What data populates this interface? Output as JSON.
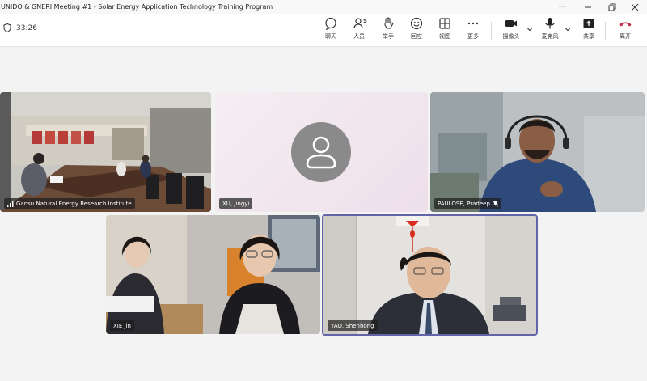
{
  "window": {
    "title": "UNIDO & GNERI Meeting #1 - Solar Energy Application Technology Training Program"
  },
  "toolbar": {
    "timer": "33:26",
    "chat_label": "聊天",
    "people_label": "人员",
    "people_count": "5",
    "raise_hand_label": "举手",
    "react_label": "回应",
    "view_label": "视图",
    "more_label": "更多",
    "camera_label": "摄像头",
    "mic_label": "麦克风",
    "share_label": "共享",
    "leave_label": "离开"
  },
  "participants": [
    {
      "name": "Gansu Natural Energy Research Institute"
    },
    {
      "name": "XU, Jingyi"
    },
    {
      "name": "PAULOSE, Pradeep"
    },
    {
      "name": "XIE Jin"
    },
    {
      "name": "YAO, Shenhong"
    }
  ],
  "colors": {
    "leave": "#c4314b",
    "active_speaker_border": "#6264a7",
    "avatar_bg": "#8a8a8a"
  }
}
